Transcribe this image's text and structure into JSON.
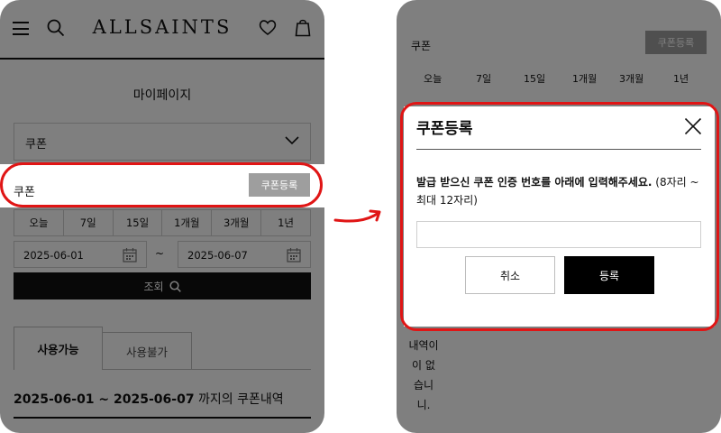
{
  "colors": {
    "highlight": "#e01515",
    "button_gray": "#9e9e9e",
    "primary": "#000000"
  },
  "header": {
    "brand": "ALLSAINTS",
    "icons": [
      "menu-icon",
      "search-icon",
      "heart-icon",
      "bag-icon"
    ]
  },
  "page": {
    "title": "마이페이지",
    "select_value": "쿠폰",
    "coupon_row": {
      "label": "쿠폰",
      "register_button": "쿠폰등록"
    },
    "periods": [
      "오늘",
      "7일",
      "15일",
      "1개월",
      "3개월",
      "1년"
    ],
    "date_start": "2025-06-01",
    "date_separator": "~",
    "date_end": "2025-06-07",
    "search_button": "조회",
    "tabs": [
      "사용가능",
      "사용불가"
    ],
    "range_bold": "2025-06-01 ~ 2025-06-07",
    "range_suffix": " 까지의 쿠폰내역"
  },
  "background": {
    "label": "쿠폰",
    "button": "쿠폰등록",
    "periods": [
      "오늘",
      "7일",
      "15일",
      "1개월",
      "3개월",
      "1년"
    ],
    "empty_lines": [
      "내역이",
      "이 없",
      "습니",
      "니."
    ]
  },
  "modal": {
    "title": "쿠폰등록",
    "instruction_bold": "발급 받으신 쿠폰 인증 번호를 아래에 입력해주세요.",
    "instruction_rest": " (8자리 ~ 최대 12자리)",
    "code_input_value": "",
    "cancel_button": "취소",
    "register_button": "등록"
  }
}
